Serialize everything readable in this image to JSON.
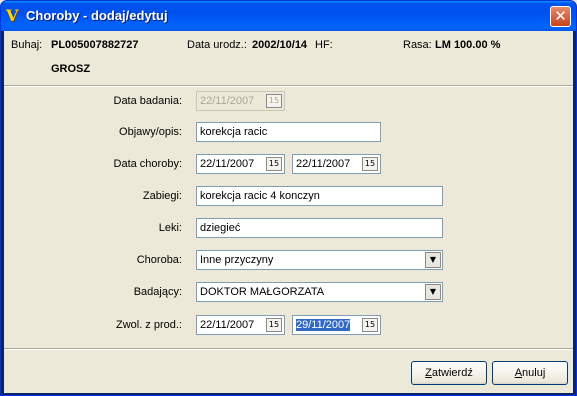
{
  "window": {
    "title": "Choroby - dodaj/edytuj",
    "close": "✕"
  },
  "header": {
    "buhaj_label": "Buhaj:",
    "buhaj_value": "PL005007882727",
    "buhaj_name": "GROSZ",
    "data_urodz_label": "Data urodz.:",
    "data_urodz_value": "2002/10/14",
    "hf_label": "HF:",
    "rasa_label": "Rasa:",
    "rasa_value": "LM 100.00 %"
  },
  "form": {
    "data_badania": {
      "label": "Data badania:",
      "value": "22/11/2007"
    },
    "objawy": {
      "label": "Objawy/opis:",
      "value": "korekcja racic"
    },
    "data_choroby": {
      "label": "Data choroby:",
      "from": "22/11/2007",
      "to": "22/11/2007"
    },
    "zabiegi": {
      "label": "Zabiegi:",
      "value": "korekcja racic 4 konczyn"
    },
    "leki": {
      "label": "Leki:",
      "value": "dziegieć"
    },
    "choroba": {
      "label": "Choroba:",
      "value": "Inne przyczyny"
    },
    "badajacy": {
      "label": "Badający:",
      "value": "DOKTOR MAŁGORZATA"
    },
    "zwol": {
      "label": "Zwol. z prod.:",
      "from": "22/11/2007",
      "to": "29/11/2007"
    },
    "calendar_glyph": "15",
    "dropdown_glyph": "▼"
  },
  "buttons": {
    "confirm_accel": "Z",
    "confirm_rest": "atwierdź",
    "cancel_accel": "A",
    "cancel_rest": "nuluj"
  }
}
